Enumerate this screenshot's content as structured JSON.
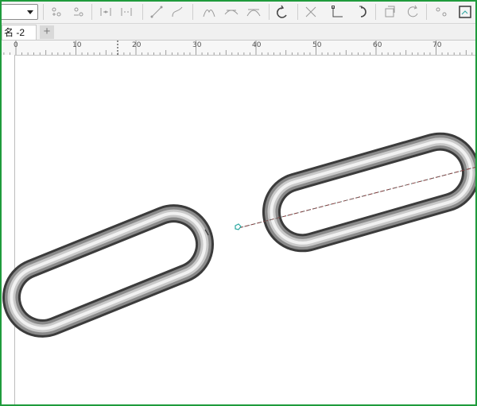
{
  "toolbar": {
    "icons": [
      "node-add-icon",
      "node-delete-icon",
      "join-nodes-icon",
      "break-curve-icon",
      "to-line-icon",
      "to-curve-icon",
      "cusp-node-icon",
      "smooth-node-icon",
      "symmetrical-node-icon",
      "reverse-direction-icon",
      "extend-curve-icon",
      "extract-subpath-icon",
      "elastic-mode-icon",
      "rotate-nodes-icon",
      "align-nodes-icon",
      "reflect-nodes-icon"
    ]
  },
  "tab": {
    "document_title": "名 -2",
    "new_tab_label": "+"
  },
  "ruler": {
    "labels": [
      "0",
      "10",
      "20",
      "30",
      "40",
      "50",
      "60",
      "70"
    ]
  },
  "colors": {
    "frame_border": "#1f9b3c",
    "link_stroke_dark": "#3a3a3a",
    "guide_line": "#7a3b3b",
    "node_marker": "#2aa7a0"
  }
}
